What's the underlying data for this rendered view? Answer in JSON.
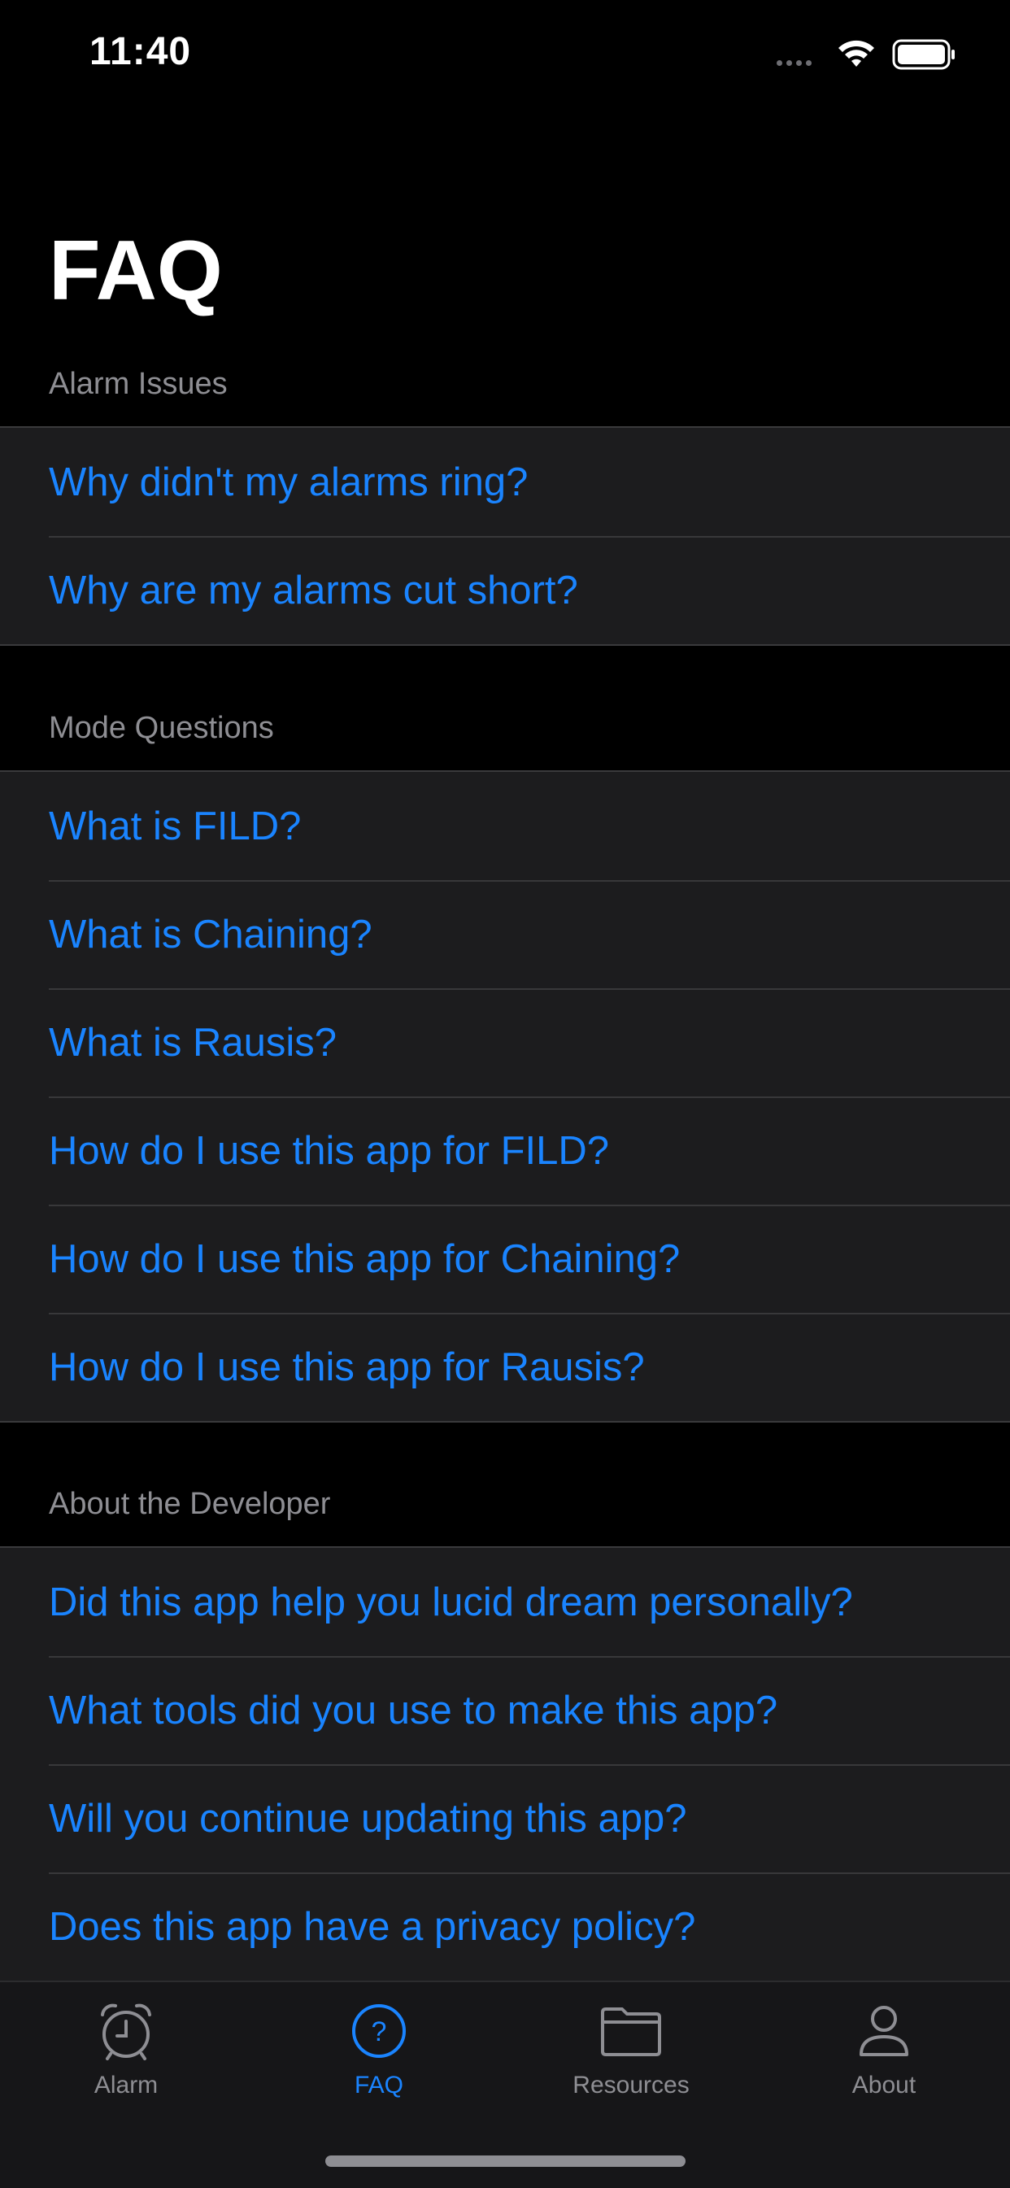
{
  "status_bar": {
    "time": "11:40"
  },
  "page": {
    "title": "FAQ"
  },
  "sections": [
    {
      "header": "Alarm Issues",
      "items": [
        "Why didn't my alarms ring?",
        "Why are my alarms cut short?"
      ]
    },
    {
      "header": "Mode Questions",
      "items": [
        "What is FILD?",
        "What is Chaining?",
        "What is Rausis?",
        "How do I use this app for FILD?",
        "How do I use this app for Chaining?",
        "How do I use this app for Rausis?"
      ]
    },
    {
      "header": "About the Developer",
      "items": [
        "Did this app help you lucid dream personally?",
        "What tools did you use to make this app?",
        "Will you continue updating this app?",
        "Does this app have a privacy policy?"
      ]
    }
  ],
  "tab_bar": {
    "tabs": [
      {
        "label": "Alarm",
        "icon": "alarm-clock-icon",
        "active": false
      },
      {
        "label": "FAQ",
        "icon": "question-circle-icon",
        "active": true
      },
      {
        "label": "Resources",
        "icon": "folder-icon",
        "active": false
      },
      {
        "label": "About",
        "icon": "person-icon",
        "active": false
      }
    ]
  },
  "colors": {
    "accent": "#1a84ff",
    "background": "#000000",
    "cell_background": "#1c1c1e",
    "secondary_text": "#8e8e93"
  }
}
